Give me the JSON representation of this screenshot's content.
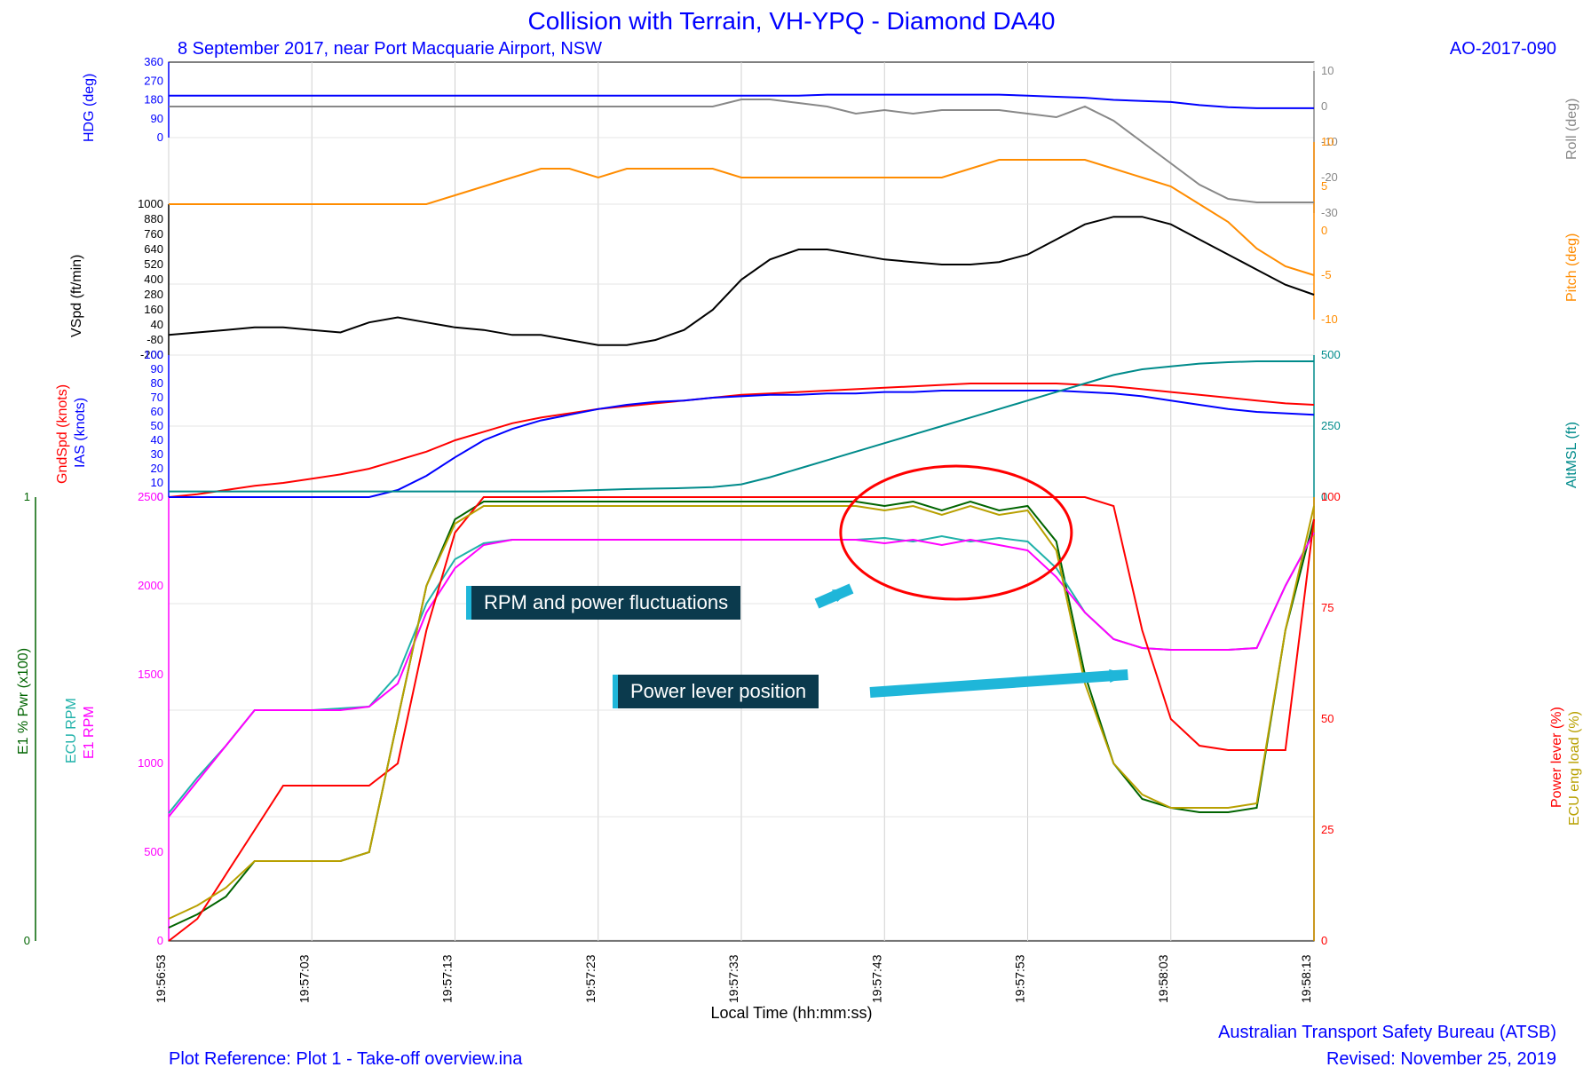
{
  "title": "Collision with Terrain, VH-YPQ - Diamond DA40",
  "subtitle": "8 September 2017, near Port Macquarie Airport, NSW",
  "report_no": "AO-2017-090",
  "x_label": "Local Time (hh:mm:ss)",
  "plot_ref": "Plot Reference: Plot 1 - Take-off overview.ina",
  "atsb": "Australian Transport Safety Bureau (ATSB)",
  "revised": "Revised: November 25, 2019",
  "annotations": {
    "rpm_fluct": "RPM and power fluctuations",
    "powerlever": "Power lever position"
  },
  "axis_labels": {
    "hdg": "HDG (deg)",
    "roll": "Roll (deg)",
    "pitch": "Pitch (deg)",
    "vspd": "VSpd (ft/min)",
    "gndspd": "GndSpd (knots)",
    "ias": "IAS (knots)",
    "altmsl": "AltMSL (ft)",
    "e1pwr": "E1 % Pwr (x100)",
    "ecurpm": "ECU RPM",
    "e1rpm": "E1 RPM",
    "powerlever": "Power lever (%)",
    "ecuengload": "ECU eng load (%)"
  },
  "x_ticks": [
    "19:56:53",
    "19:57:03",
    "19:57:13",
    "19:57:23",
    "19:57:33",
    "19:57:43",
    "19:57:53",
    "19:58:03",
    "19:58:13"
  ],
  "chart_data": {
    "type": "line",
    "x": [
      0,
      2,
      4,
      6,
      8,
      10,
      12,
      14,
      16,
      18,
      20,
      22,
      24,
      26,
      28,
      30,
      32,
      34,
      36,
      38,
      40,
      42,
      44,
      46,
      48,
      50,
      52,
      54,
      56,
      58,
      60,
      62,
      64,
      66,
      68,
      70,
      72,
      74,
      76,
      78,
      80
    ],
    "x_unit": "seconds from 19:56:53",
    "title": "Collision with Terrain, VH-YPQ - Diamond DA40",
    "xlabel": "Local Time (hh:mm:ss)",
    "series": [
      {
        "name": "HDG (deg)",
        "color": "#0000ff",
        "axis": "hdg",
        "ylim": [
          0,
          360
        ],
        "values": [
          200,
          200,
          200,
          200,
          200,
          200,
          200,
          200,
          200,
          200,
          200,
          200,
          200,
          200,
          200,
          200,
          200,
          200,
          200,
          200,
          200,
          200,
          200,
          205,
          205,
          205,
          205,
          205,
          205,
          205,
          200,
          195,
          190,
          180,
          175,
          170,
          155,
          145,
          140,
          140,
          140
        ]
      },
      {
        "name": "Roll (deg)",
        "color": "#888888",
        "axis": "roll",
        "ylim": [
          -30,
          10
        ],
        "values": [
          0,
          0,
          0,
          0,
          0,
          0,
          0,
          0,
          0,
          0,
          0,
          0,
          0,
          0,
          0,
          0,
          0,
          0,
          0,
          0,
          2,
          2,
          1,
          0,
          -2,
          -1,
          -2,
          -1,
          -1,
          -1,
          -2,
          -3,
          0,
          -4,
          -10,
          -16,
          -22,
          -26,
          -27,
          -27,
          -27
        ]
      },
      {
        "name": "Pitch (deg)",
        "color": "#ff8c00",
        "axis": "pitch",
        "ylim": [
          -10,
          10
        ],
        "values": [
          3,
          3,
          3,
          3,
          3,
          3,
          3,
          3,
          3,
          3,
          4,
          5,
          6,
          7,
          7,
          6,
          7,
          7,
          7,
          7,
          6,
          6,
          6,
          6,
          6,
          6,
          6,
          6,
          7,
          8,
          8,
          8,
          8,
          7,
          6,
          5,
          3,
          1,
          -2,
          -4,
          -5
        ]
      },
      {
        "name": "VSpd (ft/min)",
        "color": "#000000",
        "axis": "vspd",
        "ylim": [
          -200,
          1000
        ],
        "values": [
          -40,
          -20,
          0,
          20,
          20,
          0,
          -20,
          60,
          100,
          60,
          20,
          0,
          -40,
          -40,
          -80,
          -120,
          -120,
          -80,
          0,
          160,
          400,
          560,
          640,
          640,
          600,
          560,
          540,
          520,
          520,
          540,
          600,
          720,
          840,
          900,
          900,
          840,
          720,
          600,
          480,
          360,
          280
        ]
      },
      {
        "name": "GndSpd (knots)",
        "color": "#ff0000",
        "axis": "gndias",
        "ylim": [
          0,
          100
        ],
        "values": [
          0,
          2,
          5,
          8,
          10,
          13,
          16,
          20,
          26,
          32,
          40,
          46,
          52,
          56,
          59,
          62,
          64,
          66,
          68,
          70,
          72,
          73,
          74,
          75,
          76,
          77,
          78,
          79,
          80,
          80,
          80,
          80,
          79,
          78,
          76,
          74,
          72,
          70,
          68,
          66,
          65
        ]
      },
      {
        "name": "IAS (knots)",
        "color": "#0000ff",
        "axis": "gndias",
        "ylim": [
          0,
          100
        ],
        "values": [
          0,
          0,
          0,
          0,
          0,
          0,
          0,
          0,
          5,
          15,
          28,
          40,
          48,
          54,
          58,
          62,
          65,
          67,
          68,
          70,
          71,
          72,
          72,
          73,
          73,
          74,
          74,
          75,
          75,
          75,
          75,
          75,
          74,
          73,
          71,
          68,
          65,
          62,
          60,
          59,
          58
        ]
      },
      {
        "name": "AltMSL (ft)",
        "color": "#008b8b",
        "axis": "altmsl",
        "ylim": [
          0,
          500
        ],
        "values": [
          20,
          20,
          20,
          20,
          20,
          20,
          20,
          20,
          20,
          20,
          20,
          20,
          20,
          20,
          22,
          25,
          28,
          30,
          32,
          35,
          45,
          70,
          100,
          130,
          160,
          190,
          220,
          250,
          280,
          310,
          340,
          370,
          400,
          430,
          450,
          460,
          470,
          475,
          478,
          478,
          478
        ]
      },
      {
        "name": "E1 % Pwr (x100)",
        "color": "#006400",
        "axis": "e1pwr",
        "ylim": [
          0,
          1
        ],
        "values": [
          0.03,
          0.06,
          0.1,
          0.18,
          0.18,
          0.18,
          0.18,
          0.2,
          0.5,
          0.8,
          0.95,
          0.99,
          0.99,
          0.99,
          0.99,
          0.99,
          0.99,
          0.99,
          0.99,
          0.99,
          0.99,
          0.99,
          0.99,
          0.99,
          0.99,
          0.98,
          0.99,
          0.97,
          0.99,
          0.97,
          0.98,
          0.9,
          0.6,
          0.4,
          0.32,
          0.3,
          0.29,
          0.29,
          0.3,
          0.7,
          0.95
        ]
      },
      {
        "name": "ECU RPM",
        "color": "#20b2aa",
        "axis": "rpm",
        "ylim": [
          0,
          2500
        ],
        "values": [
          720,
          920,
          1100,
          1300,
          1300,
          1300,
          1310,
          1320,
          1500,
          1900,
          2150,
          2240,
          2260,
          2260,
          2260,
          2260,
          2260,
          2260,
          2260,
          2260,
          2260,
          2260,
          2260,
          2260,
          2260,
          2270,
          2250,
          2280,
          2250,
          2270,
          2250,
          2100,
          1850,
          1700,
          1650,
          1640,
          1640,
          1640,
          1650,
          2000,
          2300
        ]
      },
      {
        "name": "E1 RPM",
        "color": "#ff00ff",
        "axis": "rpm",
        "ylim": [
          0,
          2500
        ],
        "values": [
          700,
          900,
          1100,
          1300,
          1300,
          1300,
          1300,
          1320,
          1450,
          1850,
          2100,
          2230,
          2260,
          2260,
          2260,
          2260,
          2260,
          2260,
          2260,
          2260,
          2260,
          2260,
          2260,
          2260,
          2260,
          2240,
          2260,
          2230,
          2260,
          2230,
          2200,
          2050,
          1850,
          1700,
          1650,
          1640,
          1640,
          1640,
          1650,
          2000,
          2300
        ]
      },
      {
        "name": "Power lever (%)",
        "color": "#ff0000",
        "axis": "powerlever",
        "ylim": [
          0,
          100
        ],
        "values": [
          0,
          5,
          15,
          25,
          35,
          35,
          35,
          35,
          40,
          70,
          92,
          100,
          100,
          100,
          100,
          100,
          100,
          100,
          100,
          100,
          100,
          100,
          100,
          100,
          100,
          100,
          100,
          100,
          100,
          100,
          100,
          100,
          100,
          98,
          70,
          50,
          44,
          43,
          43,
          43,
          95
        ]
      },
      {
        "name": "ECU eng load (%)",
        "color": "#b8a000",
        "axis": "ecuengload",
        "ylim": [
          0,
          100
        ],
        "values": [
          5,
          8,
          12,
          18,
          18,
          18,
          18,
          20,
          50,
          80,
          94,
          98,
          98,
          98,
          98,
          98,
          98,
          98,
          98,
          98,
          98,
          98,
          98,
          98,
          98,
          97,
          98,
          96,
          98,
          96,
          97,
          88,
          58,
          40,
          33,
          30,
          30,
          30,
          31,
          70,
          98
        ]
      }
    ],
    "annotations": [
      {
        "label": "RPM and power fluctuations",
        "target_x_range": [
          48,
          63
        ],
        "target_series": [
          "ECU RPM",
          "E1 RPM",
          "E1 % Pwr (x100)",
          "ECU eng load (%)"
        ]
      },
      {
        "label": "Power lever position",
        "target_x": 68,
        "target_series": [
          "Power lever (%)"
        ]
      }
    ]
  }
}
